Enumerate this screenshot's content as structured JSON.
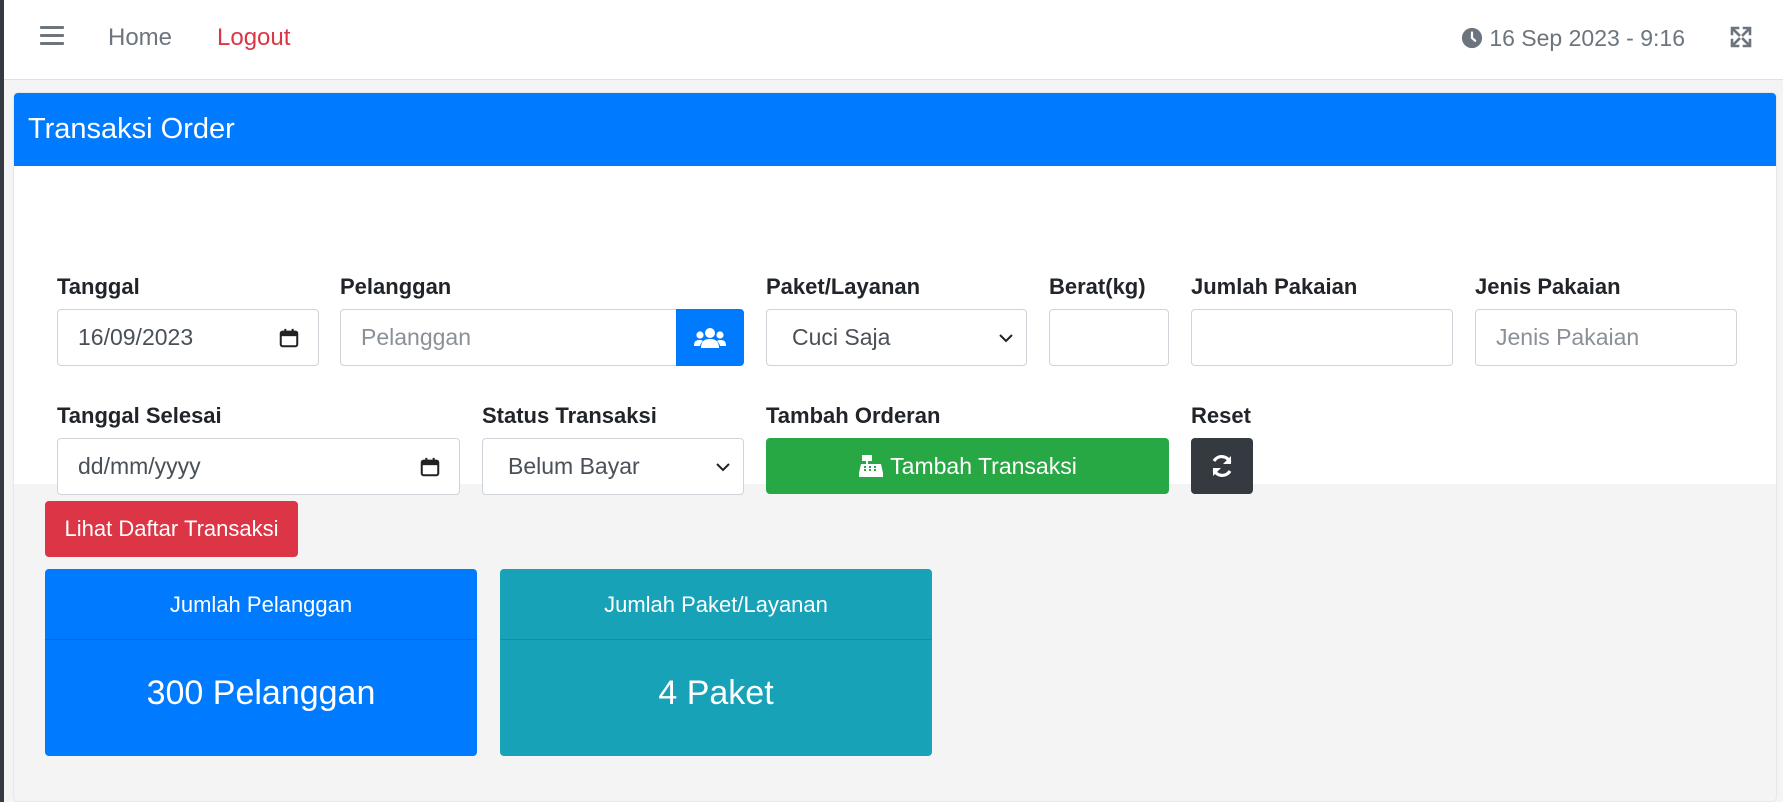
{
  "navbar": {
    "home": "Home",
    "logout": "Logout",
    "clock": "16 Sep 2023 - 9:16"
  },
  "card": {
    "title": "Transaksi Order"
  },
  "form": {
    "tanggal": {
      "label": "Tanggal",
      "value": "16/09/2023"
    },
    "pelanggan": {
      "label": "Pelanggan",
      "placeholder": "Pelanggan"
    },
    "paket": {
      "label": "Paket/Layanan",
      "selected": "Cuci Saja"
    },
    "berat": {
      "label": "Berat(kg)",
      "value": ""
    },
    "jumlah_pakaian": {
      "label": "Jumlah Pakaian",
      "value": ""
    },
    "jenis_pakaian": {
      "label": "Jenis Pakaian",
      "placeholder": "Jenis Pakaian"
    },
    "tanggal_selesai": {
      "label": "Tanggal Selesai",
      "placeholder": "dd/mm/yyyy"
    },
    "status": {
      "label": "Status Transaksi",
      "selected": "Belum Bayar"
    },
    "tambah": {
      "label": "Tambah Orderan",
      "button": "Tambah Transaksi"
    },
    "reset": {
      "label": "Reset"
    }
  },
  "lower": {
    "list_button": "Lihat Daftar Transaksi",
    "stats": [
      {
        "title": "Jumlah Pelanggan",
        "value": "300 Pelanggan"
      },
      {
        "title": "Jumlah Paket/Layanan",
        "value": "4 Paket"
      }
    ]
  },
  "colors": {
    "primary": "#007bff",
    "success": "#28a745",
    "danger": "#dc3545",
    "dark": "#343a40",
    "info": "#17a2b8"
  }
}
